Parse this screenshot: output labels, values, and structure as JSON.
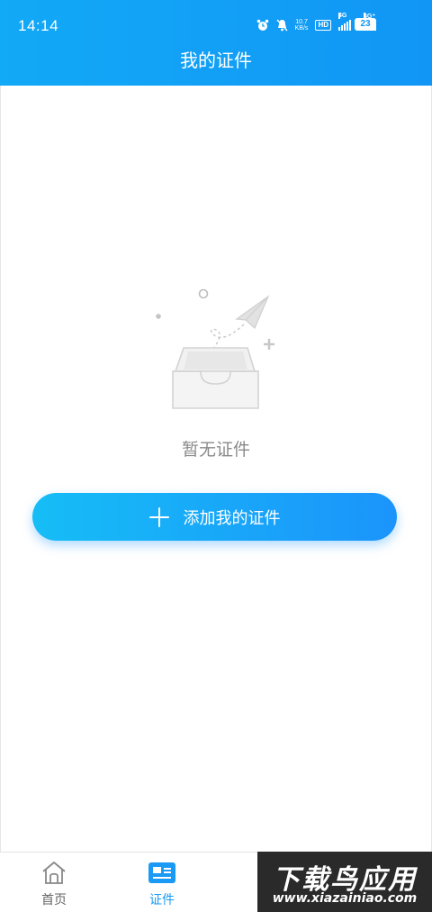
{
  "status_bar": {
    "time": "14:14",
    "net_speed_value": "10.7",
    "net_speed_unit": "KB/s",
    "hd_label": "HD",
    "signal1_label": "4G",
    "signal2_label": "4G⁺",
    "battery": "23"
  },
  "header": {
    "title": "我的证件"
  },
  "empty_state": {
    "message": "暂无证件",
    "illustration_icon": "empty-inbox-paper-plane-icon"
  },
  "add_button": {
    "label": "添加我的证件",
    "icon": "plus-icon"
  },
  "tabs": [
    {
      "label": "首页",
      "icon": "home-icon",
      "active": false
    },
    {
      "label": "证件",
      "icon": "id-card-icon",
      "active": true
    }
  ],
  "watermark": {
    "title": "下载鸟应用",
    "url": "www.xiazainiao.com"
  },
  "colors": {
    "header_start": "#12a9f6",
    "header_end": "#1196f5",
    "button_start": "#16bdf6",
    "button_end": "#1b94fb",
    "active_tab": "#1b9af5",
    "muted_text": "#8a8a8a"
  }
}
